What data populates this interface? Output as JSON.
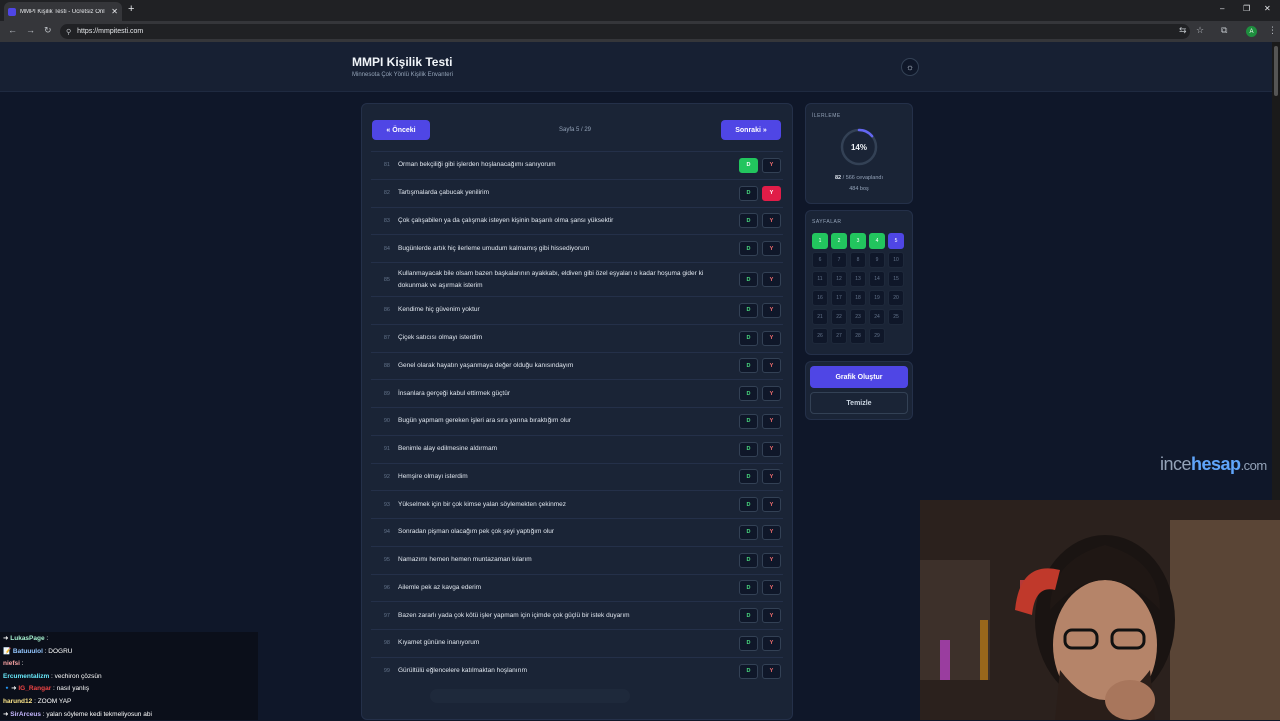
{
  "browser": {
    "tab_title": "MMPI Kişilik Testi - Ücretsiz Onl",
    "url": "https://mmpitesti.com"
  },
  "header": {
    "title": "MMPI Kişilik Testi",
    "subtitle": "Minnesota Çok Yönlü Kişilik Envanteri"
  },
  "nav": {
    "prev_label": "« Önceki",
    "next_label": "Sonraki »",
    "page_indicator": "Sayfa 5 / 29"
  },
  "answer_labels": {
    "yes": "D",
    "no": "Y"
  },
  "questions": [
    {
      "num": "81",
      "text": "Orman bekçiliği gibi işlerden hoşlanacağımı sanıyorum",
      "answer": "D"
    },
    {
      "num": "82",
      "text": "Tartışmalarda çabucak yenilirim",
      "answer": "Y"
    },
    {
      "num": "83",
      "text": "Çok çalışabilen ya da çalışmak isteyen kişinin başarılı olma şansı yüksektir",
      "answer": ""
    },
    {
      "num": "84",
      "text": "Bugünlerde artık hiç ilerleme umudum kalmamış gibi hissediyorum",
      "answer": ""
    },
    {
      "num": "85",
      "text": "Kullanmayacak bile olsam bazen başkalarının ayakkabı, eldiven gibi özel eşyaları o kadar hoşuma gider ki dokunmak ve aşırmak isterim",
      "answer": ""
    },
    {
      "num": "86",
      "text": "Kendime hiç güvenim yoktur",
      "answer": ""
    },
    {
      "num": "87",
      "text": "Çiçek satıcısı olmayı isterdim",
      "answer": ""
    },
    {
      "num": "88",
      "text": "Genel olarak hayatın yaşanmaya değer olduğu kanısındayım",
      "answer": ""
    },
    {
      "num": "89",
      "text": "İnsanlara gerçeği kabul ettirmek güçtür",
      "answer": ""
    },
    {
      "num": "90",
      "text": "Bugün yapmam gereken işleri ara sıra yarına bıraktığım olur",
      "answer": ""
    },
    {
      "num": "91",
      "text": "Benimle alay edilmesine aldırmam",
      "answer": ""
    },
    {
      "num": "92",
      "text": "Hemşire olmayı isterdim",
      "answer": ""
    },
    {
      "num": "93",
      "text": "Yükselmek için bir çok kimse yalan söylemekten çekinmez",
      "answer": ""
    },
    {
      "num": "94",
      "text": "Sonradan pişman olacağım pek çok şeyi yaptığım olur",
      "answer": ""
    },
    {
      "num": "95",
      "text": "Namazımı hemen hemen muntazaman kılarım",
      "answer": ""
    },
    {
      "num": "96",
      "text": "Ailemle pek az kavga ederim",
      "answer": ""
    },
    {
      "num": "97",
      "text": "Bazen zararlı yada çok kötü işler yapmam için içimde çok güçlü bir istek duyarım",
      "answer": ""
    },
    {
      "num": "98",
      "text": "Kıyamet gününe inanıyorum",
      "answer": ""
    },
    {
      "num": "99",
      "text": "Gürültülü eğlencelere katılmaktan hoşlanırım",
      "answer": ""
    }
  ],
  "progress": {
    "label": "İLERLEME",
    "percent": 14,
    "percent_text": "14%",
    "answered": "82",
    "answered_suffix": " / 566 cevaplandı",
    "empty_text": "484 boş"
  },
  "pages": {
    "label": "SAYFALAR",
    "current": 5,
    "done": [
      1,
      2,
      3,
      4
    ],
    "total": 29
  },
  "actions": {
    "chart_label": "Grafik Oluştur",
    "clear_label": "Temizle"
  },
  "colors": {
    "accent": "#4f46e5",
    "yes_green": "#22c55e",
    "no_red": "#e11d48",
    "background": "#0f1729"
  },
  "watermark": {
    "part1": "ince",
    "part2": "hesap",
    "part3": ".com"
  },
  "chat": [
    {
      "user": "LukasPage",
      "msg": "",
      "color": "#a7f3d0",
      "prefix": "➜ "
    },
    {
      "user": "Batuuulol",
      "msg": "DOGRU",
      "color": "#93c5fd",
      "prefix": "  📝 "
    },
    {
      "user": "niefsi",
      "msg": "",
      "color": "#fca5a5",
      "prefix": ""
    },
    {
      "user": "Ercumentalizm",
      "msg": "vechiron çözsün",
      "color": "#67e8f9",
      "prefix": ""
    },
    {
      "user": "IG_Rangar",
      "msg": "nasıl yanlış",
      "color": "#ef4444",
      "prefix": "🔹➜ "
    },
    {
      "user": "harund12",
      "msg": "ZOOM YAP",
      "color": "#fde68a",
      "prefix": ""
    },
    {
      "user": "SirArceus",
      "msg": "yalan söyleme kedi tekmeliyosun abi",
      "color": "#c4b5fd",
      "prefix": "  ➜ "
    }
  ]
}
